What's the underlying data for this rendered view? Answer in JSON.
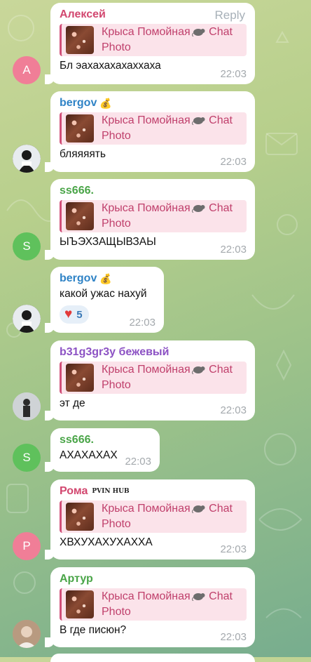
{
  "colors": {
    "quote_accent": "#d14f78",
    "quote_bg": "#fbe3ea",
    "time": "#a4a9ad",
    "reply": "#a7b0b8"
  },
  "messages": [
    {
      "sender": "Алексей",
      "sender_color": "#d2476f",
      "avatar_letter": "А",
      "avatar_color": "#f07e97",
      "reply_action": "Reply",
      "quote_title": "Крыса Помойная",
      "quote_chat": "Chat",
      "quote_sub": "Photo",
      "text": "Бл эахахахахаххаха",
      "time": "22:03"
    },
    {
      "sender": "bergov",
      "sender_color": "#2f83c6",
      "sender_badge": "money-bag-icon",
      "avatar_letter": "",
      "avatar_color": "#1c1c1c",
      "quote_title": "Крыса Помойная",
      "quote_chat": "Chat",
      "quote_sub": "Photo",
      "text": "бляяяять",
      "time": "22:03"
    },
    {
      "sender": "ss666.",
      "sender_color": "#4aa548",
      "avatar_letter": "S",
      "avatar_color": "#5fc15c",
      "quote_title": "Крыса Помойная",
      "quote_chat": "Chat",
      "quote_sub": "Photo",
      "text": "ЫЪЭХЗАЩЫВЗАЫ",
      "time": "22:03"
    },
    {
      "sender": "bergov",
      "sender_color": "#2f83c6",
      "sender_badge": "money-bag-icon",
      "avatar_letter": "",
      "avatar_color": "#1c1c1c",
      "text": "какой ужас нахуй",
      "reaction_emoji": "heart-icon",
      "reaction_count": "5",
      "time": "22:03"
    },
    {
      "sender": "b31g3gr3y бежевый",
      "sender_color": "#8c52c4",
      "avatar_letter": "",
      "avatar_color": "#d0d0d0",
      "quote_title": "Крыса Помойная",
      "quote_chat": "Chat",
      "quote_sub": "Photo",
      "text": "эт де",
      "time": "22:03"
    },
    {
      "sender": "ss666.",
      "sender_color": "#4aa548",
      "avatar_letter": "S",
      "avatar_color": "#5fc15c",
      "text": "АХАХАХАХ",
      "time": "22:03"
    },
    {
      "sender": "Рома",
      "sender_badge_text": "PVIN HUB",
      "sender_color": "#d2476f",
      "avatar_letter": "Р",
      "avatar_color": "#f07e97",
      "quote_title": "Крыса Помойная",
      "quote_chat": "Chat",
      "quote_sub": "Photo",
      "text": "ХВХУХАХУХАХХА",
      "time": "22:03"
    },
    {
      "sender": "Артур",
      "sender_color": "#4aa548",
      "avatar_letter": "",
      "avatar_color": "#caa68a",
      "quote_title": "Крыса Помойная",
      "quote_chat": "Chat",
      "quote_sub": "Photo",
      "text": "В где писюн?",
      "time": "22:03"
    }
  ]
}
